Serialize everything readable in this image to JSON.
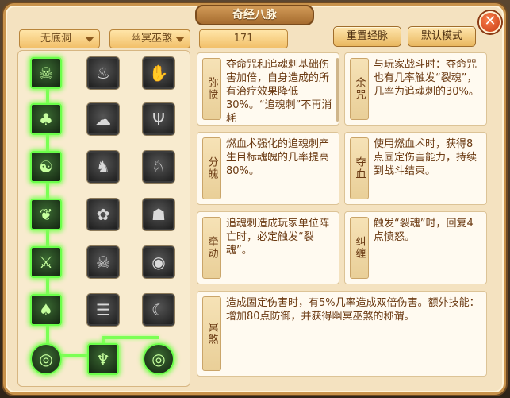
{
  "window": {
    "title": "奇经八脉",
    "close_label": "✕"
  },
  "toolbar": {
    "school": "无底洞",
    "branch": "幽冥巫煞",
    "points": "171",
    "reset_label": "重置经脉",
    "default_label": "默认模式"
  },
  "tree": {
    "rows": [
      {
        "nodes": [
          {
            "icon": "spirit-icon",
            "glyph": "☠",
            "active": true
          },
          {
            "icon": "claw-icon",
            "glyph": "♨",
            "active": false
          },
          {
            "icon": "hand-icon",
            "glyph": "✋",
            "active": false
          }
        ]
      },
      {
        "nodes": [
          {
            "icon": "ghost-icon",
            "glyph": "♣",
            "active": true
          },
          {
            "icon": "wraith-icon",
            "glyph": "☁",
            "active": false
          },
          {
            "icon": "fork-icon",
            "glyph": "Ψ",
            "active": false
          }
        ]
      },
      {
        "nodes": [
          {
            "icon": "demon-icon",
            "glyph": "☯",
            "active": true
          },
          {
            "icon": "warrior-icon",
            "glyph": "♞",
            "active": false
          },
          {
            "icon": "beast-icon",
            "glyph": "♘",
            "active": false
          }
        ]
      },
      {
        "nodes": [
          {
            "icon": "leaf-icon",
            "glyph": "❦",
            "active": true
          },
          {
            "icon": "rose-icon",
            "glyph": "✿",
            "active": false
          },
          {
            "icon": "shade-icon",
            "glyph": "☗",
            "active": false
          }
        ]
      },
      {
        "nodes": [
          {
            "icon": "blade-icon",
            "glyph": "⚔",
            "active": true
          },
          {
            "icon": "skull-icon",
            "glyph": "☠",
            "active": false
          },
          {
            "icon": "swirl-icon",
            "glyph": "◉",
            "active": false
          }
        ]
      },
      {
        "nodes": [
          {
            "icon": "mask-icon",
            "glyph": "♠",
            "active": true
          },
          {
            "icon": "scroll-icon",
            "glyph": "☰",
            "active": false
          },
          {
            "icon": "bow-icon",
            "glyph": "☾",
            "active": false
          }
        ]
      },
      {
        "nodes": [
          {
            "icon": "orb-icon",
            "glyph": "◎",
            "active": true
          },
          {
            "icon": "poison-icon",
            "glyph": "♆",
            "active": true
          },
          {
            "icon": "vortex-icon",
            "glyph": "◎",
            "active": true
          }
        ]
      }
    ]
  },
  "cards": [
    {
      "name": "弥愤",
      "desc": "夺命咒和追魂刺基础伤害加倍，自身造成的所有治疗效果降低30%。“追魂刺”不再消耗"
    },
    {
      "name": "余咒",
      "desc": "与玩家战斗时：夺命咒也有几率触发“裂魂”，几率为追魂刺的30%。"
    },
    {
      "name": "分魄",
      "desc": "燃血术强化的追魂刺产生目标魂魄的几率提高80%。"
    },
    {
      "name": "夺血",
      "desc": "使用燃血术时，获得8点固定伤害能力，持续到战斗结束。"
    },
    {
      "name": "牵动",
      "desc": "追魂刺造成玩家单位阵亡时，必定触发“裂魂”。"
    },
    {
      "name": "纠缠",
      "desc": "触发“裂魂”时，回复4点愤怒。"
    },
    {
      "name": "冥煞",
      "desc": "造成固定伤害时，有5%几率造成双倍伤害。额外技能：增加80点防御，并获得幽冥巫煞的称谓。"
    }
  ]
}
